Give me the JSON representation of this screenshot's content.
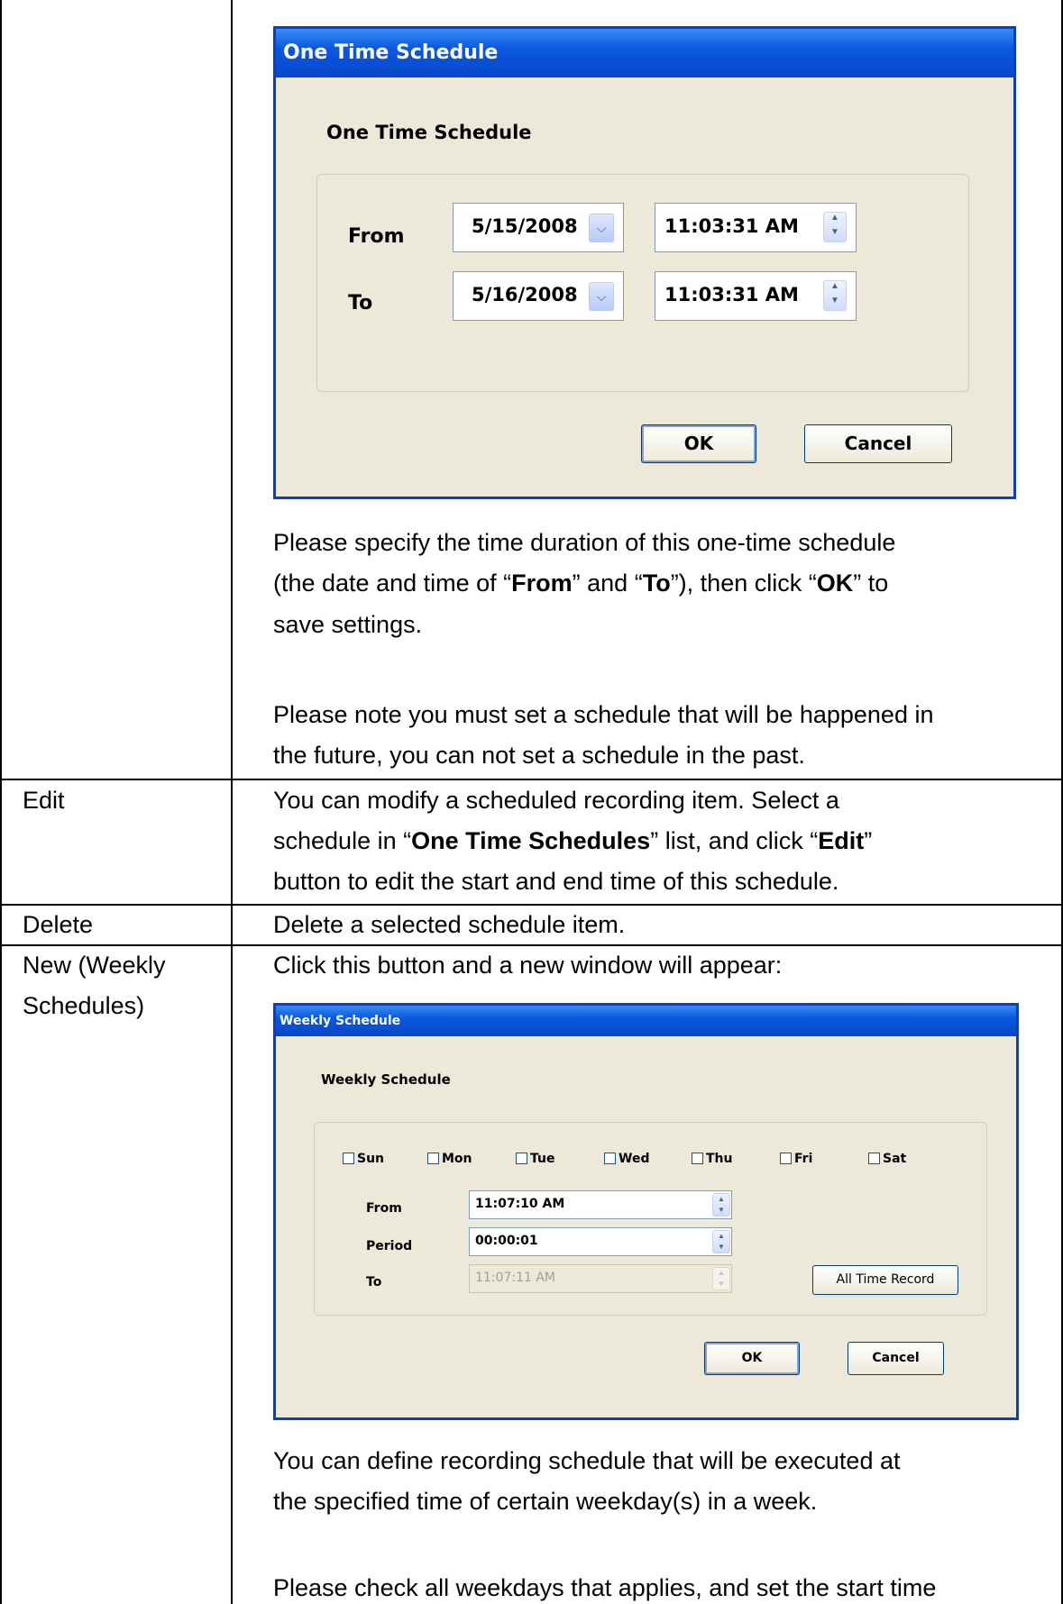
{
  "dialog1": {
    "title": "One Time Schedule",
    "heading": "One Time Schedule",
    "from_label": "From",
    "to_label": "To",
    "from_date": "5/15/2008",
    "from_time": "11:03:31 AM",
    "to_date": "5/16/2008",
    "to_time": "11:03:31 AM",
    "ok": "OK",
    "cancel": "Cancel"
  },
  "row1": {
    "p1_l1": "Please specify the time duration of this one-time schedule",
    "p1_l2_a": "(the date and time of “",
    "p1_l2_b": "From",
    "p1_l2_c": "” and “",
    "p1_l2_d": "To",
    "p1_l2_e": "”), then click “",
    "p1_l2_f": "OK",
    "p1_l2_g": "” to",
    "p1_l3": "save settings.",
    "p2_l1": "Please note you must set a schedule that will be happened in",
    "p2_l2": "the future, you can not set a schedule in the past."
  },
  "row_edit": {
    "term": "Edit",
    "l1": "You can modify a scheduled recording item. Select a",
    "l2_a": "schedule in “",
    "l2_b": "One Time Schedules",
    "l2_c": "” list, and click “",
    "l2_d": "Edit",
    "l2_e": "”",
    "l3": "button to edit the start and end time of this schedule."
  },
  "row_delete": {
    "term": "Delete",
    "desc": "Delete a selected schedule item."
  },
  "row_new": {
    "term_l1": "New (Weekly",
    "term_l2": "Schedules)",
    "intro": "Click this button and a new window will appear:",
    "p1_l1": "You can define recording schedule that will be executed at",
    "p1_l2": "the specified time of certain weekday(s) in a week.",
    "p2_l1": "Please check all weekdays that applies, and set the start time"
  },
  "dialog2": {
    "title": "Weekly Schedule",
    "heading": "Weekly Schedule",
    "days": [
      "Sun",
      "Mon",
      "Tue",
      "Wed",
      "Thu",
      "Fri",
      "Sat"
    ],
    "from_label": "From",
    "period_label": "Period",
    "to_label": "To",
    "from_time": "11:07:10 AM",
    "period": "00:00:01",
    "to_time": "11:07:11 AM",
    "all_time": "All Time Record",
    "ok": "OK",
    "cancel": "Cancel"
  }
}
